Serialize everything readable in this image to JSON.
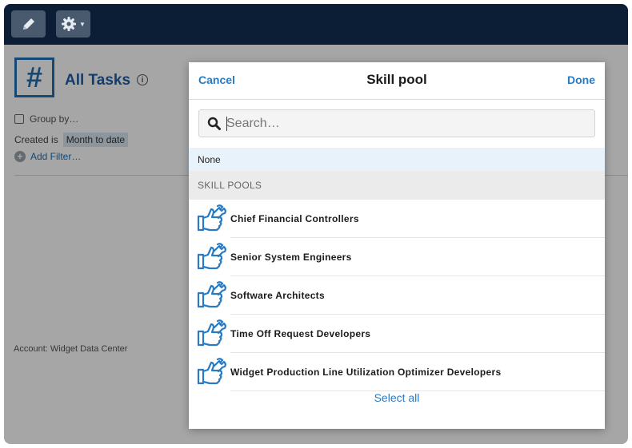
{
  "toolbar": {
    "edit_icon": "pencil-icon",
    "settings_icon": "gear-icon"
  },
  "page": {
    "title": "All Tasks",
    "group_by_label": "Group by…",
    "created_label": "Created is",
    "created_value": "Month to date",
    "add_filter_label": "Add Filter…",
    "account_text": "Account: Widget Data Center"
  },
  "modal": {
    "cancel_label": "Cancel",
    "title": "Skill pool",
    "done_label": "Done",
    "search_placeholder": "Search…",
    "none_label": "None",
    "section_header": "SKILL POOLS",
    "items": [
      {
        "label": "Chief Financial Controllers"
      },
      {
        "label": "Senior System Engineers"
      },
      {
        "label": "Software Architects"
      },
      {
        "label": "Time Off Request Developers"
      },
      {
        "label": "Widget Production Line Utilization Optimizer Developers"
      }
    ],
    "select_all_label": "Select all"
  },
  "colors": {
    "topbar": "#0b1e36",
    "accent": "#2a7ac2",
    "selected_row": "#e8f2fb"
  }
}
